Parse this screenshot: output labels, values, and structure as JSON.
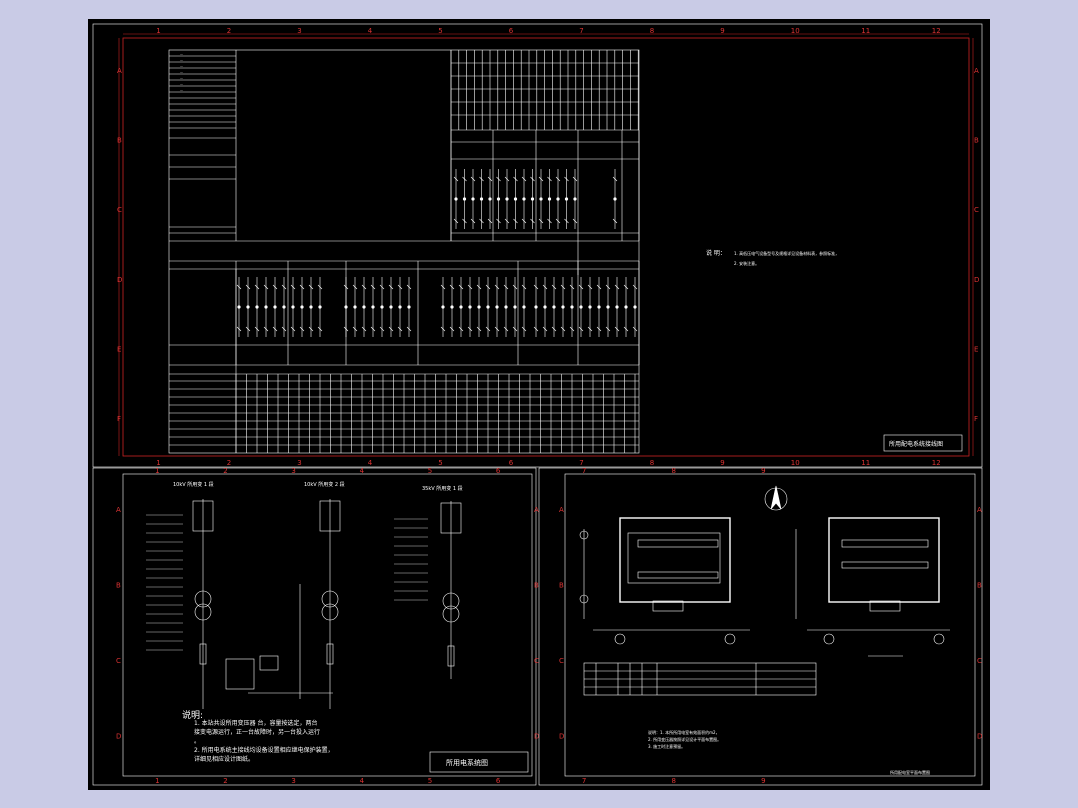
{
  "sheet_main": {
    "col_numbers": [
      "1",
      "2",
      "3",
      "4",
      "5",
      "6",
      "7",
      "8",
      "9",
      "10",
      "11",
      "12"
    ],
    "row_letters": [
      "A",
      "B",
      "C",
      "D",
      "E",
      "F"
    ],
    "notes_heading": "说 明：",
    "notes_lines": [
      "1. 高低压电气设备型号及规格详见设备材料表，参照标准，",
      "2. 安装注意。"
    ],
    "title": "所用配电系统接线图"
  },
  "sheet_left": {
    "col_numbers": [
      "1",
      "2",
      "3",
      "4",
      "5",
      "6"
    ],
    "row_letters": [
      "A",
      "B",
      "C",
      "D"
    ],
    "feeder_titles": [
      "10kV 所用变 1 段",
      "10kV 所用变 2 段",
      "35kV 所用变 1 段"
    ],
    "notes_heading": "说明:",
    "notes_lines": [
      "1. 本站共设所用变压器 台，容量按选定，两台",
      "   接变电源运行，正一台故障时，另一台投入运行",
      "   。",
      "2. 所用电系统主接线均设备设置相应继电保护装置，",
      "   详细见相应设计图纸。"
    ],
    "title": "所用电系统图"
  },
  "sheet_right": {
    "col_numbers": [
      "7",
      "8",
      "9"
    ],
    "notes_lines": [
      "说明：1. 本所所用电室有效面积约m2，",
      "2. 所用变压器按照详见设计平面布置图。",
      "3. 施工时注意预留。"
    ],
    "title": "所用配电室平面布置图"
  }
}
